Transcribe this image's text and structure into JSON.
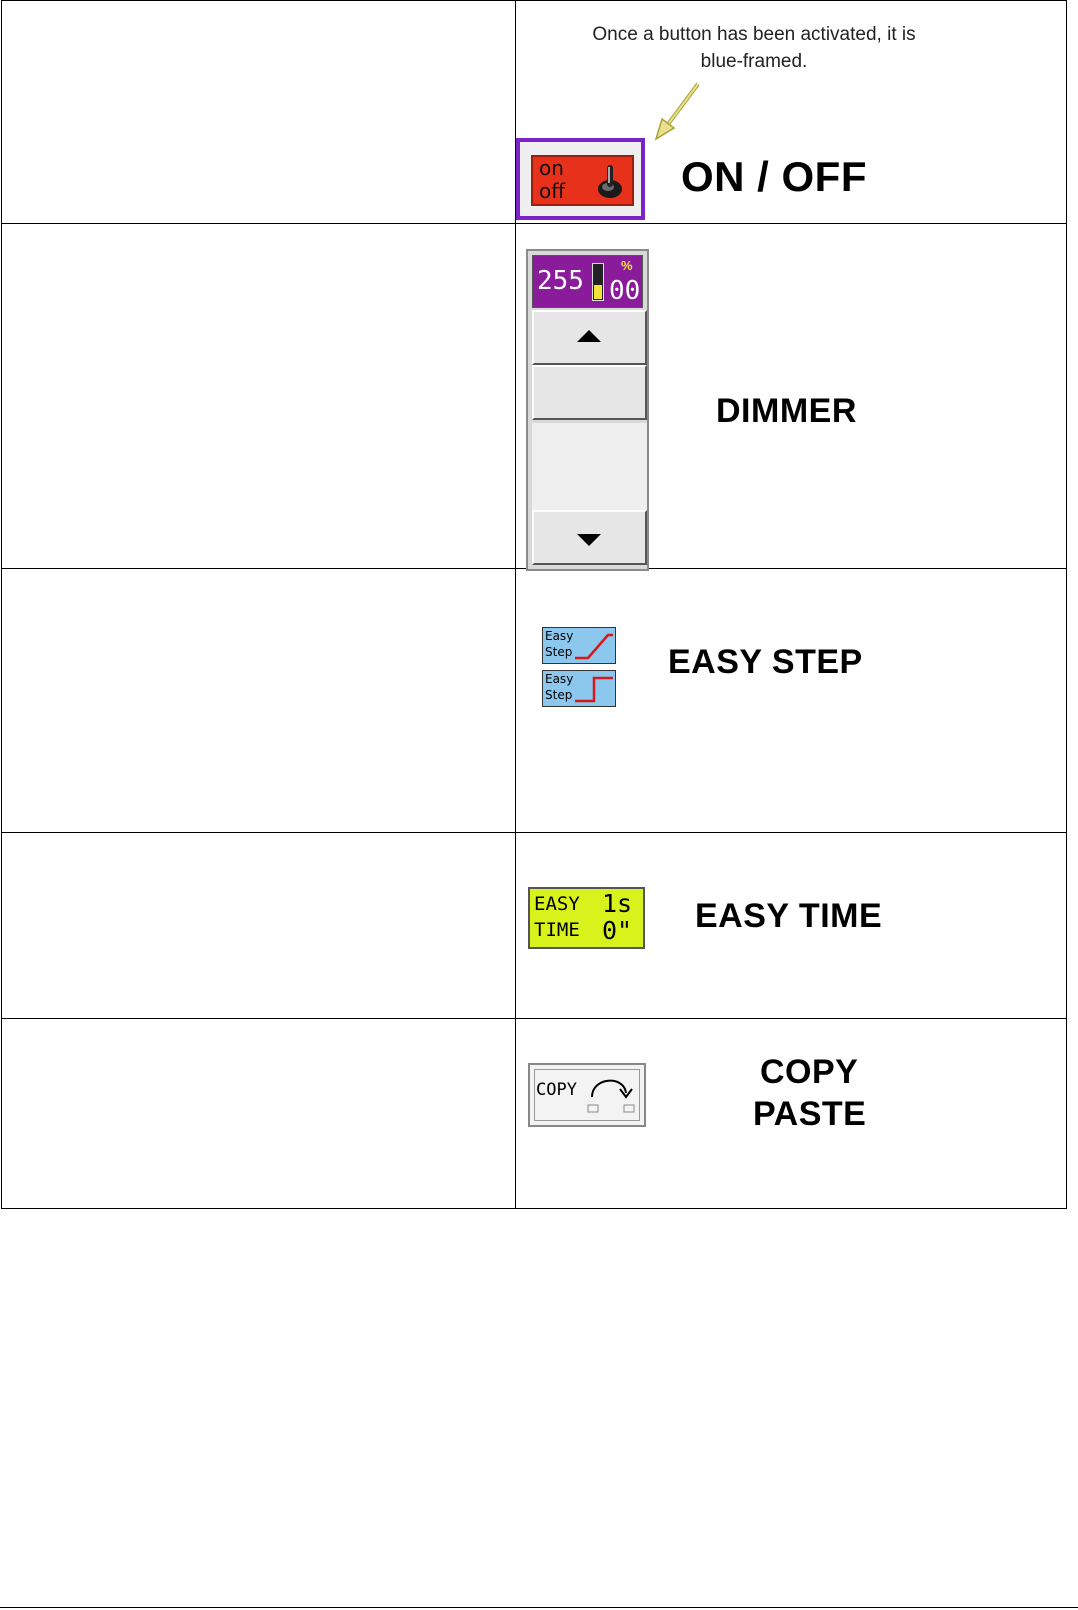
{
  "rows": [
    {
      "label": "ON / OFF",
      "note": "Once a button has been activated, it is blue-framed.",
      "widget": {
        "on_text": "on",
        "off_text": "off"
      }
    },
    {
      "label": "DIMMER",
      "widget": {
        "value": "255",
        "percent_symbol": "%",
        "percent_value": "00"
      }
    },
    {
      "label": "EASY STEP",
      "widget": {
        "line1": "Easy",
        "line2": "Step"
      }
    },
    {
      "label": "EASY TIME",
      "widget": {
        "line1_left": "EASY",
        "line1_right": "1s",
        "line2_left": "TIME",
        "line2_right": "0\""
      }
    },
    {
      "label_line1": "COPY",
      "label_line2": "PASTE",
      "widget": {
        "text": "COPY"
      }
    }
  ],
  "colors": {
    "active_frame": "#7b22c9",
    "onoff_bg": "#e8311b",
    "dimmer_display": "#8a1b9a",
    "easy_step_bg": "#8cc7ee",
    "easy_time_bg": "#d8f21c"
  },
  "icons": [
    "pointer-arrow-icon",
    "toggle-switch-icon",
    "up-arrow-icon",
    "down-arrow-icon",
    "ramp-icon",
    "step-icon",
    "curved-arrow-icon"
  ]
}
